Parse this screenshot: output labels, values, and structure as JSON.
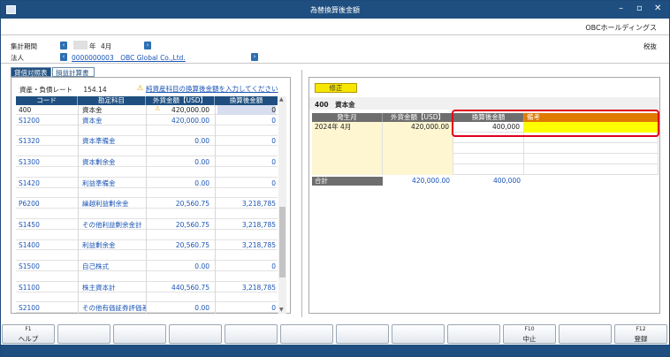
{
  "window": {
    "title": "為替換算後金額",
    "company": "OBCホールディングス"
  },
  "header": {
    "period_label": "集計期間",
    "year_suffix": "年",
    "month": "4月",
    "corp_label": "法人",
    "corp_value": "0000000003　OBC Global Co.,Ltd.",
    "right_label": "税抜"
  },
  "tabs": [
    {
      "label": "貸借対照表",
      "active": true
    },
    {
      "label": "損益計算書",
      "active": false
    }
  ],
  "left": {
    "rate_label": "資産・負債レート",
    "rate_value": "154.14",
    "warning": "純資産科目の換算後金額を入力してください",
    "columns": [
      "コード",
      "勘定科目",
      "外貨金額【USD】",
      "換算後金額"
    ],
    "rows": [
      {
        "code": "400",
        "name": "資本金",
        "fc": "420,000.00",
        "cv": "0",
        "selected": true
      },
      {
        "code": "S1200",
        "name": "資本金",
        "fc": "420,000.00",
        "cv": "0"
      },
      {
        "code": "",
        "name": "",
        "fc": "",
        "cv": ""
      },
      {
        "code": "S1320",
        "name": "資本準備金",
        "fc": "0.00",
        "cv": "0"
      },
      {
        "code": "",
        "name": "",
        "fc": "",
        "cv": ""
      },
      {
        "code": "S1300",
        "name": "資本剰余金",
        "fc": "0.00",
        "cv": "0"
      },
      {
        "code": "",
        "name": "",
        "fc": "",
        "cv": ""
      },
      {
        "code": "S1420",
        "name": "利益準備金",
        "fc": "0.00",
        "cv": "0"
      },
      {
        "code": "",
        "name": "",
        "fc": "",
        "cv": ""
      },
      {
        "code": "P6200",
        "name": "繰越利益剰余金",
        "fc": "20,560.75",
        "cv": "3,218,785"
      },
      {
        "code": "",
        "name": "",
        "fc": "",
        "cv": ""
      },
      {
        "code": "S1450",
        "name": "その他利益剰余金計",
        "fc": "20,560.75",
        "cv": "3,218,785"
      },
      {
        "code": "",
        "name": "",
        "fc": "",
        "cv": ""
      },
      {
        "code": "S1400",
        "name": "利益剰余金",
        "fc": "20,560.75",
        "cv": "3,218,785"
      },
      {
        "code": "",
        "name": "",
        "fc": "",
        "cv": ""
      },
      {
        "code": "S1500",
        "name": "自己株式",
        "fc": "0.00",
        "cv": "0"
      },
      {
        "code": "",
        "name": "",
        "fc": "",
        "cv": ""
      },
      {
        "code": "S1100",
        "name": "株主資本計",
        "fc": "440,560.75",
        "cv": "3,218,785"
      },
      {
        "code": "",
        "name": "",
        "fc": "",
        "cv": ""
      },
      {
        "code": "S2100",
        "name": "その他有価証券評価差額金",
        "fc": "0.00",
        "cv": "0"
      }
    ]
  },
  "right": {
    "edit_label": "修正",
    "title": "400　資本金",
    "columns": [
      "発生月",
      "外貨金額【USD】",
      "換算後金額",
      "備考"
    ],
    "rows": [
      {
        "month": "2024年 4月",
        "fc": "420,000.00",
        "cv": "400,000",
        "note": ""
      },
      {
        "month": "",
        "fc": "",
        "cv": "",
        "note": ""
      },
      {
        "month": "",
        "fc": "",
        "cv": "",
        "note": ""
      },
      {
        "month": "",
        "fc": "",
        "cv": "",
        "note": ""
      },
      {
        "month": "",
        "fc": "",
        "cv": "",
        "note": ""
      }
    ],
    "total": {
      "label": "合計",
      "fc": "420,000.00",
      "cv": "400,000"
    }
  },
  "fkeys": [
    {
      "key": "F1",
      "label": "ヘルプ"
    },
    {
      "key": "",
      "label": ""
    },
    {
      "key": "",
      "label": ""
    },
    {
      "key": "",
      "label": ""
    },
    {
      "key": "",
      "label": ""
    },
    {
      "key": "",
      "label": ""
    },
    {
      "key": "",
      "label": ""
    },
    {
      "key": "",
      "label": ""
    },
    {
      "key": "",
      "label": ""
    },
    {
      "key": "F10",
      "label": "中止"
    },
    {
      "key": "",
      "label": ""
    },
    {
      "key": "F12",
      "label": "登録"
    }
  ]
}
